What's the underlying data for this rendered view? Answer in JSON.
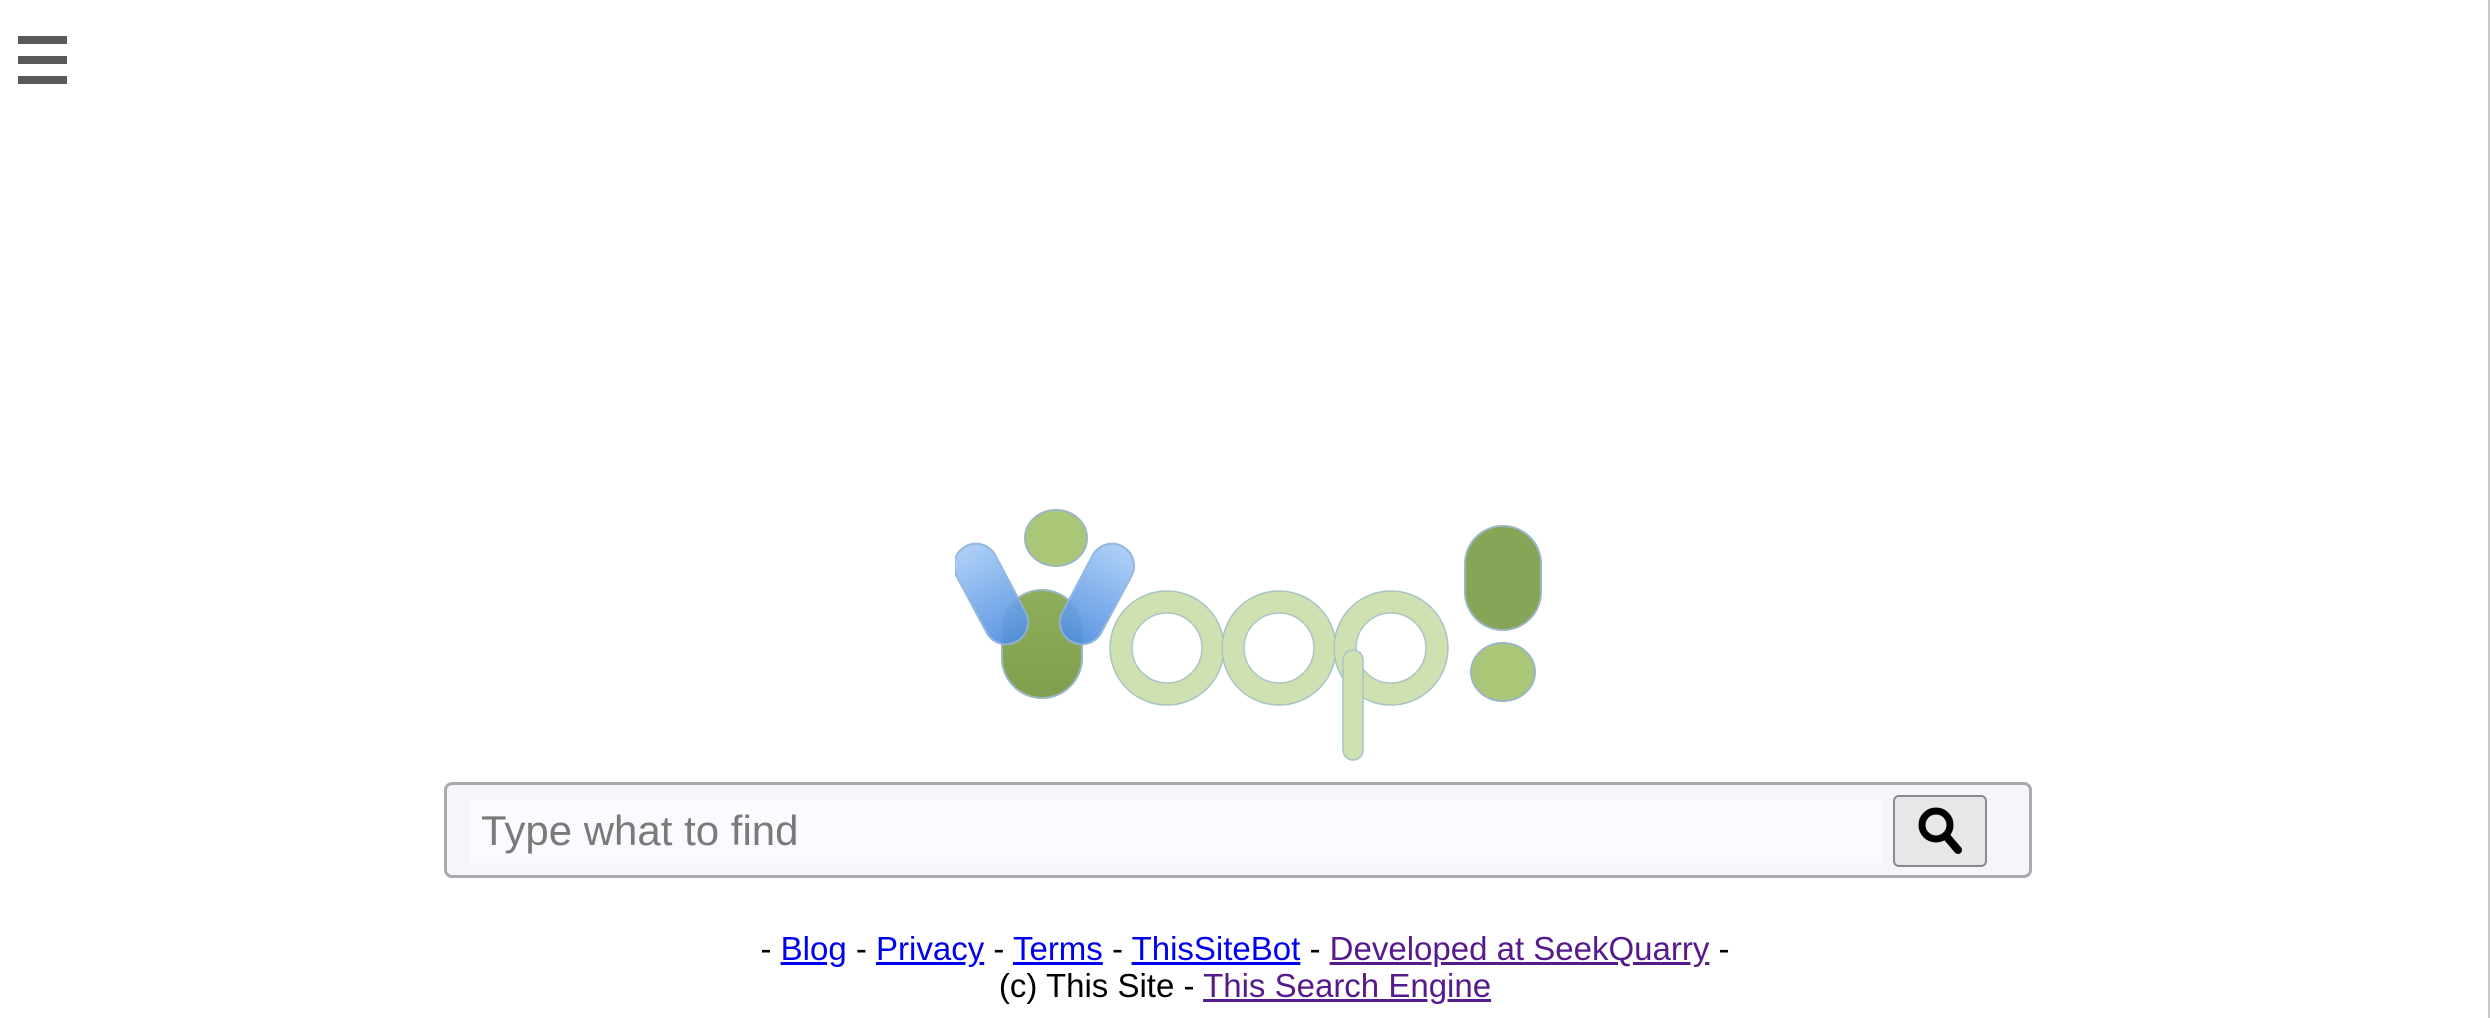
{
  "search": {
    "placeholder": "Type what to find",
    "value": ""
  },
  "footer": {
    "sep": "-",
    "links": {
      "blog": "Blog",
      "privacy": "Privacy",
      "terms": "Terms",
      "bot": "ThisSiteBot",
      "developed": "Developed at SeekQuarry",
      "engine": "This Search Engine"
    },
    "copyright_prefix": "(c) This Site"
  },
  "icons": {
    "menu": "hamburger-menu-icon",
    "search": "magnifier-icon"
  },
  "colors": {
    "logo_light_green": "#cfe1b0",
    "logo_dark_green": "#86a556",
    "logo_blue": "#6a9fe6",
    "link": "#0000ee",
    "visited_link": "#551a8b"
  },
  "logo": {
    "alt_text": "Yoop!"
  }
}
